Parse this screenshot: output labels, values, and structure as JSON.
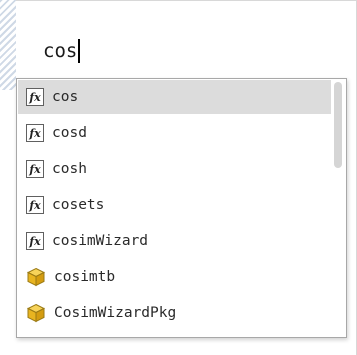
{
  "command_window": {
    "input_text": "cos"
  },
  "completion_popup": {
    "items": [
      {
        "label": "cos",
        "icon": "function-icon",
        "selected": true
      },
      {
        "label": "cosd",
        "icon": "function-icon",
        "selected": false
      },
      {
        "label": "cosh",
        "icon": "function-icon",
        "selected": false
      },
      {
        "label": "cosets",
        "icon": "function-icon",
        "selected": false
      },
      {
        "label": "cosimWizard",
        "icon": "function-icon",
        "selected": false
      },
      {
        "label": "cosimtb",
        "icon": "package-icon",
        "selected": false
      },
      {
        "label": "CosimWizardPkg",
        "icon": "package-icon",
        "selected": false
      }
    ],
    "fx_glyph": "fx",
    "colors": {
      "selected_bg": "#dcdcdc",
      "package_icon": "#f2c230",
      "border": "#a8a8a8"
    }
  }
}
